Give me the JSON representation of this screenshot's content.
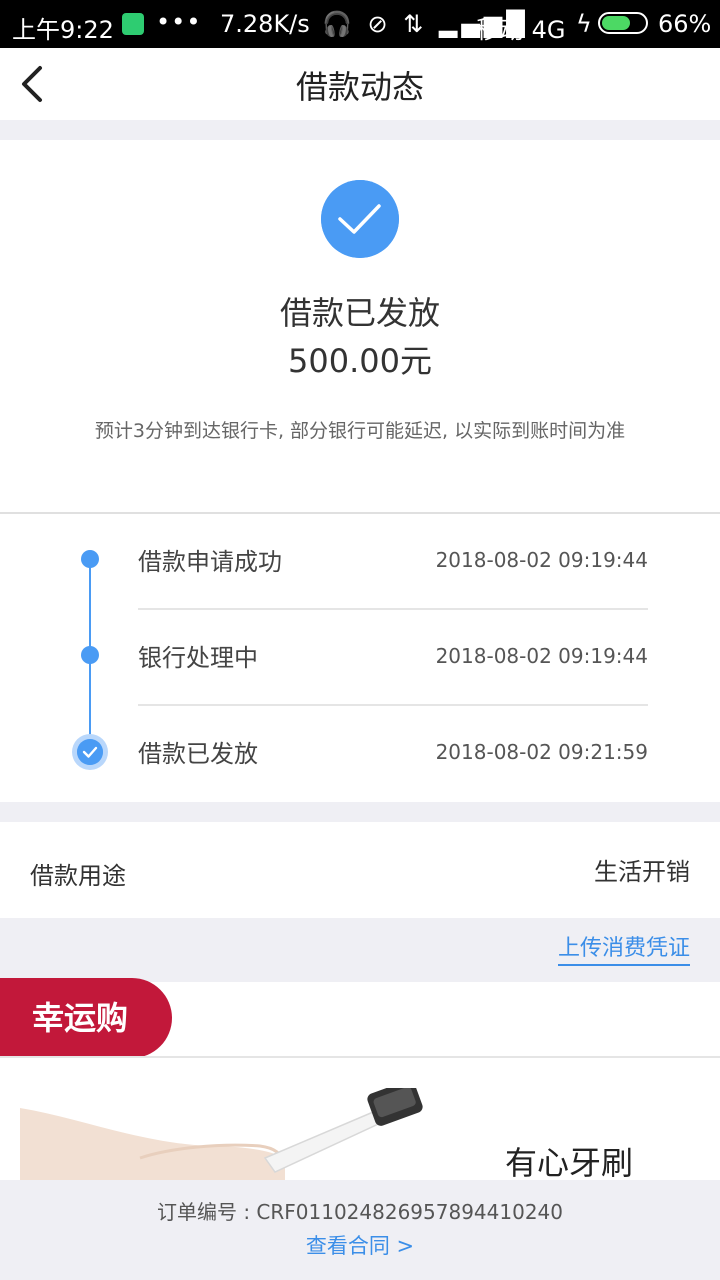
{
  "status_bar": {
    "time": "上午9:22",
    "dots": "•••",
    "speed": "7.28K/s",
    "icons": "🎧 ⊘ ⇅ ▂▄▆█",
    "carrier": "移动 4G",
    "bolt": "ϟ",
    "battery_pct": "66%",
    "battery_level": 0.66
  },
  "nav": {
    "title": "借款动态"
  },
  "hero": {
    "status": "借款已发放",
    "amount": "500.00元",
    "note": "预计3分钟到达银行卡, 部分银行可能延迟, 以实际到账时间为准",
    "accent_color": "#4a9bf4"
  },
  "timeline": [
    {
      "label": "借款申请成功",
      "time": "2018-08-02 09:19:44"
    },
    {
      "label": "银行处理中",
      "time": "2018-08-02 09:19:44"
    },
    {
      "label": "借款已发放",
      "time": "2018-08-02 09:21:59"
    }
  ],
  "purpose": {
    "label": "借款用途",
    "value": "生活开销"
  },
  "upload": {
    "label": "上传消费凭证"
  },
  "lucky": {
    "label": "幸运购",
    "color": "#c2183a"
  },
  "product": {
    "name": "有心牙刷"
  },
  "footer": {
    "order_no": "订单编号 : CRF0110248269578944102​40",
    "contract": "查看合同 >"
  }
}
